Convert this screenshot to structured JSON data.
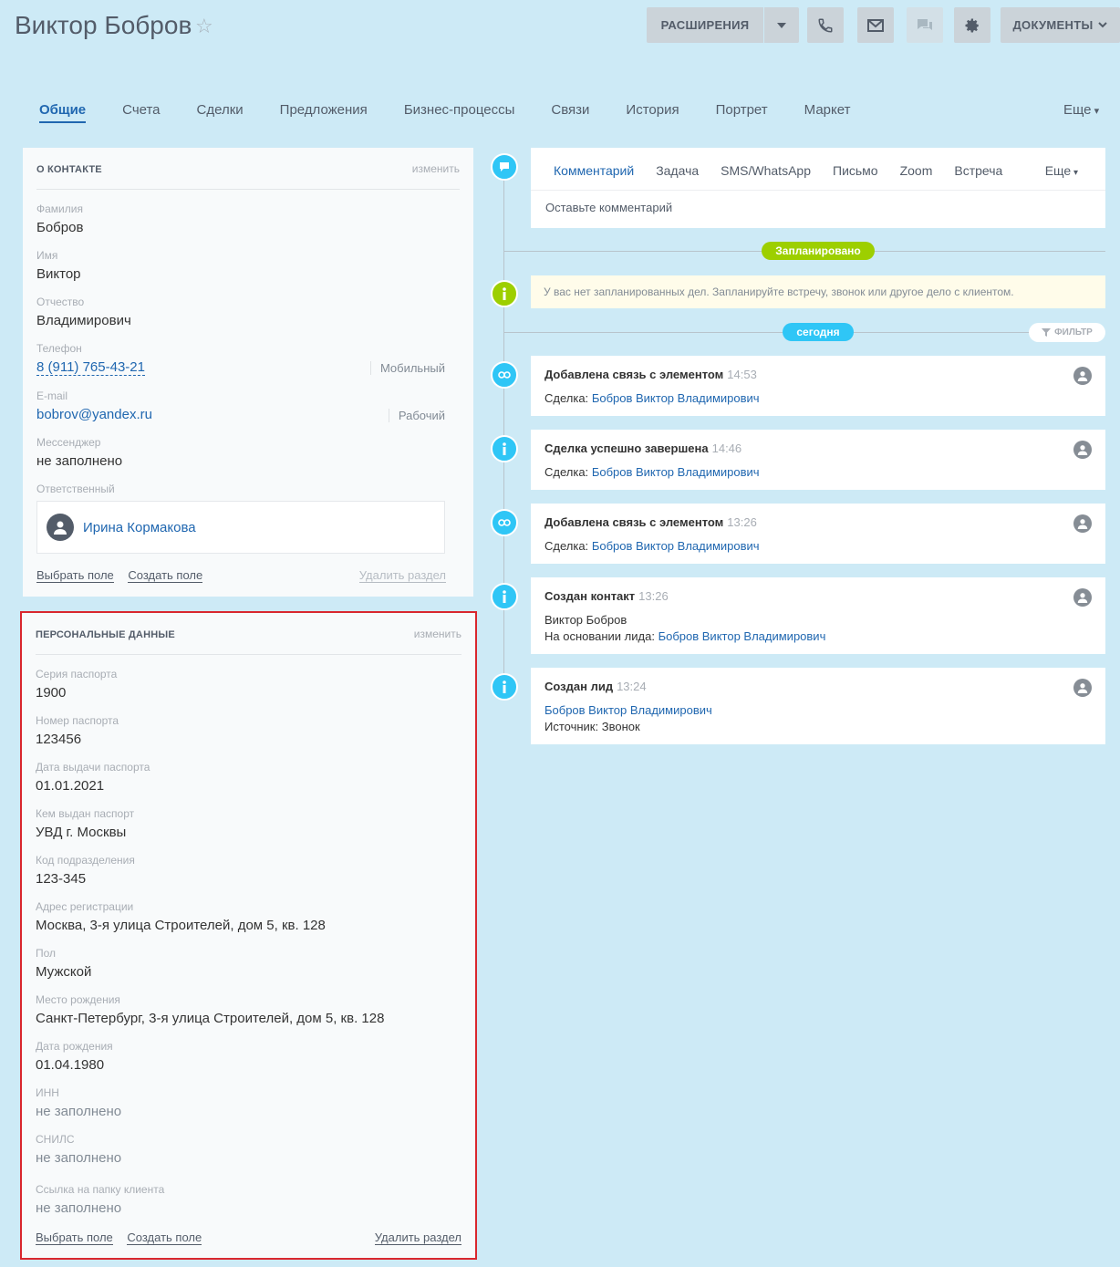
{
  "header": {
    "title": "Виктор Бобров",
    "extensions_label": "РАСШИРЕНИЯ",
    "documents_label": "ДОКУМЕНТЫ"
  },
  "tabs": [
    "Общие",
    "Счета",
    "Сделки",
    "Предложения",
    "Бизнес-процессы",
    "Связи",
    "История",
    "Портрет",
    "Маркет"
  ],
  "tabs_more": "Еще",
  "contact_card": {
    "title": "О КОНТАКТЕ",
    "edit": "изменить",
    "fields": [
      {
        "label": "Фамилия",
        "value": "Бобров"
      },
      {
        "label": "Имя",
        "value": "Виктор"
      },
      {
        "label": "Отчество",
        "value": "Владимирович"
      },
      {
        "label": "Телефон",
        "value": "8 (911) 765-43-21",
        "tag": "Мобильный"
      },
      {
        "label": "E-mail",
        "value": "bobrov@yandex.ru",
        "tag": "Рабочий"
      },
      {
        "label": "Мессенджер",
        "value": "не заполнено"
      },
      {
        "label": "Ответственный",
        "value": "Ирина Кормакова"
      }
    ],
    "select_field": "Выбрать поле",
    "create_field": "Создать поле",
    "delete_section": "Удалить раздел"
  },
  "personal_card": {
    "title": "ПЕРСОНАЛЬНЫЕ ДАННЫЕ",
    "edit": "изменить",
    "fields": [
      {
        "label": "Серия паспорта",
        "value": "1900"
      },
      {
        "label": "Номер паспорта",
        "value": "123456"
      },
      {
        "label": "Дата выдачи паспорта",
        "value": "01.01.2021"
      },
      {
        "label": "Кем выдан паспорт",
        "value": "УВД г. Москвы"
      },
      {
        "label": "Код подразделения",
        "value": "123-345"
      },
      {
        "label": "Адрес регистрации",
        "value": "Москва, 3-я улица Строителей, дом 5, кв. 128"
      },
      {
        "label": "Пол",
        "value": "Мужской"
      },
      {
        "label": "Место рождения",
        "value": "Санкт-Петербург, 3-я улица Строителей, дом 5, кв. 128"
      },
      {
        "label": "Дата рождения",
        "value": "01.04.1980"
      },
      {
        "label": "ИНН",
        "value": "не заполнено"
      },
      {
        "label": "СНИЛС",
        "value": "не заполнено"
      },
      {
        "label": "Ссылка на папку клиента",
        "value": "не заполнено"
      }
    ],
    "select_field": "Выбрать поле",
    "create_field": "Создать поле",
    "delete_section": "Удалить раздел"
  },
  "composer": {
    "tabs": [
      "Комментарий",
      "Задача",
      "SMS/WhatsApp",
      "Письмо",
      "Zoom",
      "Встреча"
    ],
    "more": "Еще",
    "placeholder": "Оставьте комментарий"
  },
  "timeline": {
    "planned_label": "Запланировано",
    "notice": "У вас нет запланированных дел. Запланируйте встречу, звонок или другое дело с клиентом.",
    "today_label": "сегодня",
    "filter_label": "ФИЛЬТР",
    "events": [
      {
        "title": "Добавлена связь с элементом",
        "time": "14:53",
        "prefix": "Сделка:",
        "link": "Бобров Виктор Владимирович"
      },
      {
        "title": "Сделка успешно завершена",
        "time": "14:46",
        "prefix": "Сделка:",
        "link": "Бобров Виктор Владимирович"
      },
      {
        "title": "Добавлена связь с элементом",
        "time": "13:26",
        "prefix": "Сделка:",
        "link": "Бобров Виктор Владимирович"
      },
      {
        "title": "Создан контакт",
        "time": "13:26",
        "line1": "Виктор Бобров",
        "prefix": "На основании лида:",
        "link": "Бобров Виктор Владимирович"
      },
      {
        "title": "Создан лид",
        "time": "13:24",
        "link": "Бобров Виктор Владимирович",
        "line2": "Источник: Звонок"
      }
    ]
  }
}
